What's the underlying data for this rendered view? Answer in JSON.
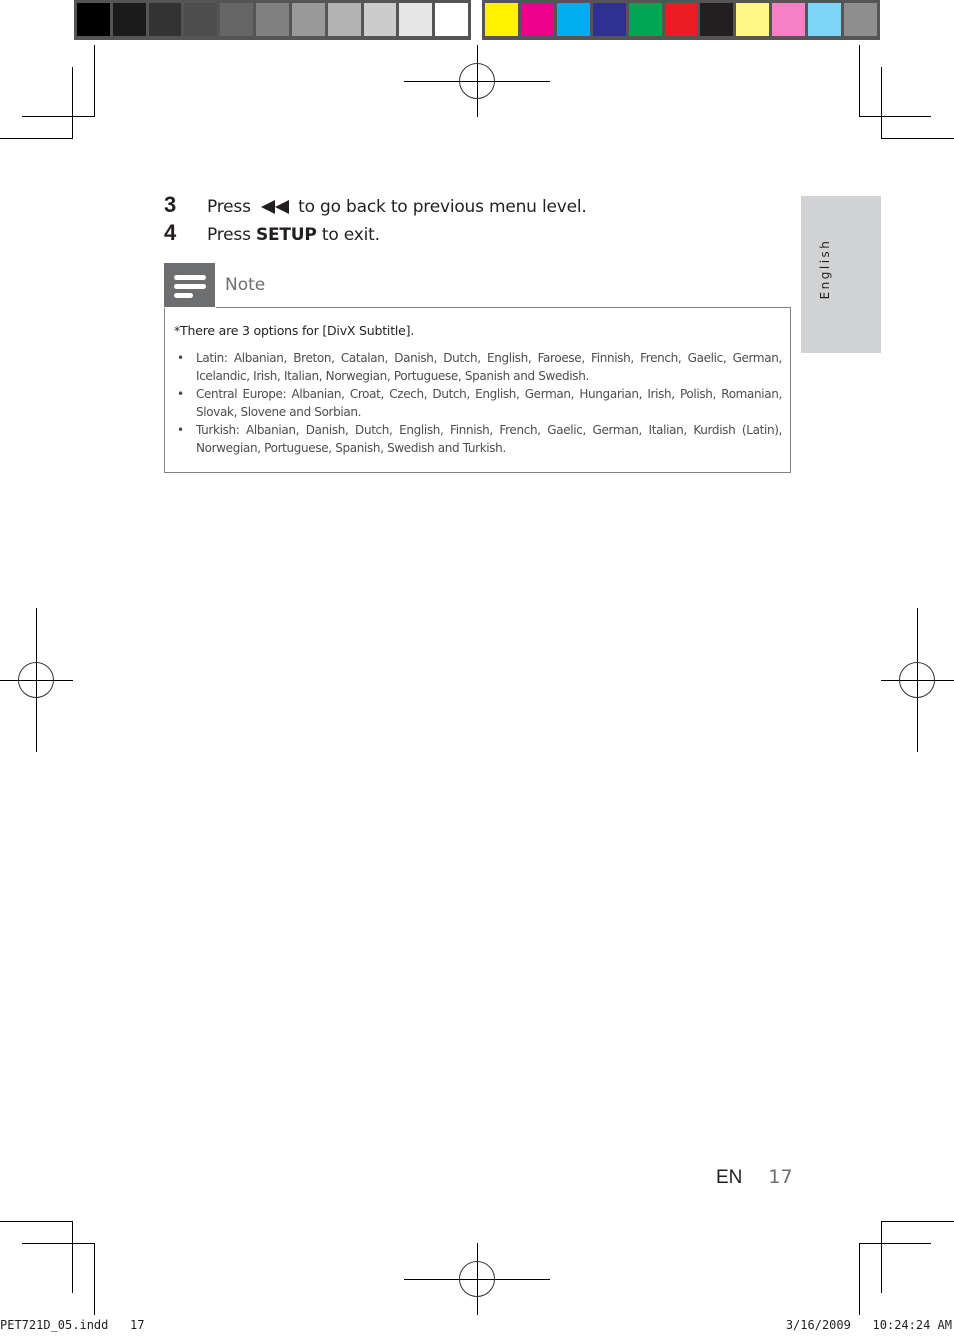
{
  "color_bars": {
    "grayscale": [
      "#000000",
      "#1b1b1b",
      "#333333",
      "#4d4d4d",
      "#666666",
      "#808080",
      "#999999",
      "#b3b3b3",
      "#cccccc",
      "#e6e6e6",
      "#ffffff"
    ],
    "process": [
      "#fff200",
      "#ec008c",
      "#00aeef",
      "#2e3192",
      "#00a651",
      "#ed1c24",
      "#231f20",
      "#fff685",
      "#f680c5",
      "#7dd5f7",
      "#8e8e8e"
    ]
  },
  "steps": [
    {
      "number": "3",
      "prefix": "Press",
      "icon": "rewind-icon",
      "suffix": "to go back to previous menu level."
    },
    {
      "number": "4",
      "prefix": "Press",
      "keyword": "SETUP",
      "suffix": "to exit."
    }
  ],
  "note": {
    "title": "Note",
    "intro": "*There are 3 options for [DivX Subtitle].",
    "items": [
      "Latin: Albanian, Breton, Catalan, Danish, Dutch, English, Faroese, Finnish, French, Gaelic, German, Icelandic, Irish, Italian, Norwegian, Portuguese, Spanish and Swedish.",
      "Central Europe: Albanian, Croat, Czech, Dutch, English, German, Hungarian, Irish, Polish, Romanian, Slovak, Slovene and Sorbian.",
      "Turkish: Albanian, Danish, Dutch, English, Finnish, French, Gaelic, German, Italian, Kurdish (Latin), Norwegian, Portuguese, Spanish, Swedish and Turkish."
    ],
    "bullet": "•"
  },
  "side_tab": {
    "label": "English"
  },
  "footer": {
    "lang": "EN",
    "page": "17"
  },
  "slug": {
    "file": "PET721D_05.indd   17",
    "datetime": "3/16/2009   10:24:24 AM"
  },
  "colors": {
    "text": "#231f20",
    "note_gray": "#6d6e70",
    "tab_bg": "#d1d2d3",
    "box_border": "#808080"
  }
}
